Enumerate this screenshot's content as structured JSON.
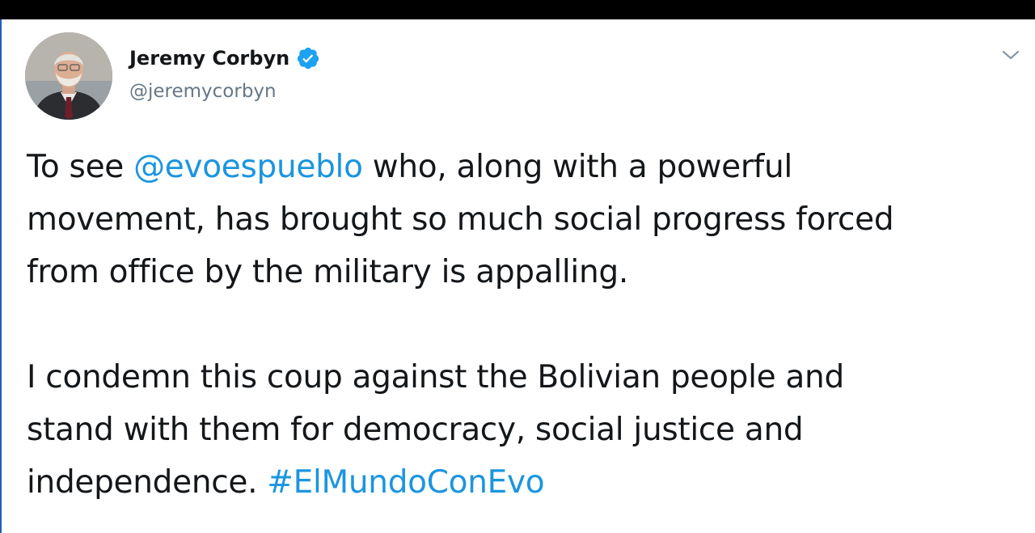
{
  "tweet": {
    "author": {
      "display_name": "Jeremy Corbyn",
      "handle": "@jeremycorbyn",
      "verified": true
    },
    "body": {
      "para1": {
        "prefix": "To see ",
        "mention": "@evoespueblo",
        "line1_rest": " who, along with a powerful",
        "line2": "movement, has brought so much social progress forced",
        "line3": "from office by the military is appalling."
      },
      "para2": {
        "line1": "I condemn this coup against the Bolivian people and",
        "line2": "stand with them for democracy, social justice and",
        "line3_prefix": "independence. ",
        "hashtag": "#ElMundoConEvo"
      }
    },
    "icons": {
      "verified": "verified-badge-icon",
      "menu": "chevron-down-icon"
    },
    "colors": {
      "link": "#1b95e0",
      "verified_badge": "#1da1f2",
      "text": "#14171a",
      "secondary_text": "#657786"
    }
  }
}
